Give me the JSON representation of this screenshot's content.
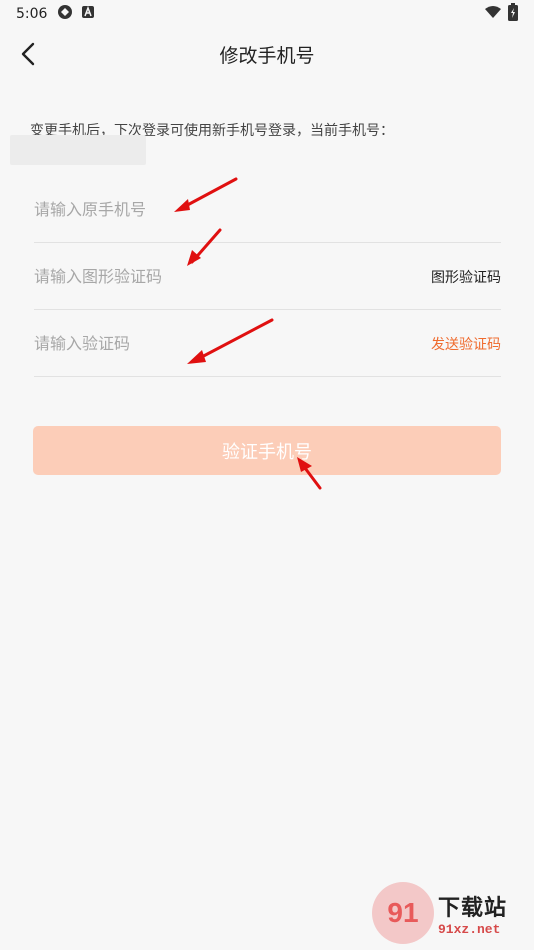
{
  "status_bar": {
    "time": "5:06"
  },
  "header": {
    "title": "修改手机号"
  },
  "hint_text": "变更手机后，下次登录可使用新手机号登录，当前手机号：",
  "form": {
    "original_phone_placeholder": "请输入原手机号",
    "captcha_placeholder": "请输入图形验证码",
    "captcha_label": "图形验证码",
    "sms_code_placeholder": "请输入验证码",
    "send_code_label": "发送验证码",
    "submit_label": "验证手机号"
  },
  "colors": {
    "accent": "#ef6b2e",
    "button_disabled": "#fccdb8",
    "annotation_arrow": "#e01010"
  },
  "watermark": {
    "brand": "下载站",
    "site": "91xz.net"
  }
}
